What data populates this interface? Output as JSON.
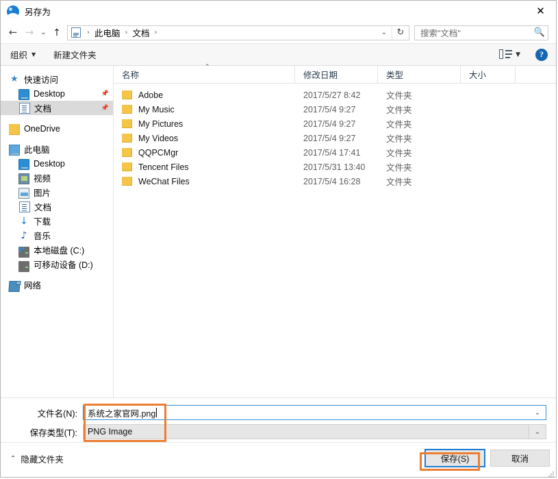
{
  "window": {
    "title": "另存为",
    "app_icon": "photos-app-icon",
    "close_label": "✕"
  },
  "addressbar": {
    "back_icon": "←",
    "forward_icon": "→",
    "history_icon": "⌄",
    "up_icon": "↑",
    "path_icon": "documents-icon",
    "crumbs": [
      "此电脑",
      "文档"
    ],
    "separator": "›",
    "dropdown_icon": "⌄",
    "refresh_icon": "↻"
  },
  "search": {
    "placeholder": "搜索\"文档\"",
    "icon": "search-icon"
  },
  "commandbar": {
    "organize_label": "组织",
    "organize_caret": "▼",
    "new_folder_label": "新建文件夹",
    "view_caret": "▼",
    "help_label": "?"
  },
  "sidebar": {
    "items": [
      {
        "label": "快速访问",
        "icon": "star-icon",
        "indent": 0,
        "selected": false,
        "pinned": false
      },
      {
        "label": "Desktop",
        "icon": "monitor-icon",
        "indent": 1,
        "selected": false,
        "pinned": true
      },
      {
        "label": "文档",
        "icon": "document-icon",
        "indent": 1,
        "selected": true,
        "pinned": true
      },
      {
        "label": "OneDrive",
        "icon": "folder-icon",
        "indent": 0,
        "selected": false,
        "pinned": false
      },
      {
        "label": "此电脑",
        "icon": "pc-icon",
        "indent": 0,
        "selected": false,
        "pinned": false
      },
      {
        "label": "Desktop",
        "icon": "monitor-icon",
        "indent": 1,
        "selected": false,
        "pinned": false
      },
      {
        "label": "视频",
        "icon": "video-icon",
        "indent": 1,
        "selected": false,
        "pinned": false
      },
      {
        "label": "图片",
        "icon": "picture-icon",
        "indent": 1,
        "selected": false,
        "pinned": false
      },
      {
        "label": "文档",
        "icon": "document-icon",
        "indent": 1,
        "selected": false,
        "pinned": false
      },
      {
        "label": "下载",
        "icon": "download-icon",
        "indent": 1,
        "selected": false,
        "pinned": false
      },
      {
        "label": "音乐",
        "icon": "music-icon",
        "indent": 1,
        "selected": false,
        "pinned": false
      },
      {
        "label": "本地磁盘 (C:)",
        "icon": "drive-icon",
        "indent": 1,
        "selected": false,
        "pinned": false
      },
      {
        "label": "可移动设备 (D:)",
        "icon": "removable-drive-icon",
        "indent": 1,
        "selected": false,
        "pinned": false
      },
      {
        "label": "网络",
        "icon": "network-icon",
        "indent": 0,
        "selected": false,
        "pinned": false
      }
    ]
  },
  "filelist": {
    "columns": [
      "名称",
      "修改日期",
      "类型",
      "大小"
    ],
    "sort_caret": "⌃",
    "rows": [
      {
        "name": "Adobe",
        "date": "2017/5/27 8:42",
        "type": "文件夹",
        "size": ""
      },
      {
        "name": "My Music",
        "date": "2017/5/4 9:27",
        "type": "文件夹",
        "size": ""
      },
      {
        "name": "My Pictures",
        "date": "2017/5/4 9:27",
        "type": "文件夹",
        "size": ""
      },
      {
        "name": "My Videos",
        "date": "2017/5/4 9:27",
        "type": "文件夹",
        "size": ""
      },
      {
        "name": "QQPCMgr",
        "date": "2017/5/4 17:41",
        "type": "文件夹",
        "size": ""
      },
      {
        "name": "Tencent Files",
        "date": "2017/5/31 13:40",
        "type": "文件夹",
        "size": ""
      },
      {
        "name": "WeChat Files",
        "date": "2017/5/4 16:28",
        "type": "文件夹",
        "size": ""
      }
    ]
  },
  "form": {
    "filename_label": "文件名(N):",
    "filename_value": "系统之家官网.png",
    "filetype_label": "保存类型(T):",
    "filetype_value": "PNG Image",
    "dropdown_icon": "⌄"
  },
  "footer": {
    "hide_folders_label": "隐藏文件夹",
    "hide_folders_chev": "⌃",
    "save_label": "保存(S)",
    "cancel_label": "取消"
  },
  "annotations": {
    "color": "#ED7D31",
    "boxes": [
      "filename-and-type-fields",
      "save-button"
    ]
  }
}
